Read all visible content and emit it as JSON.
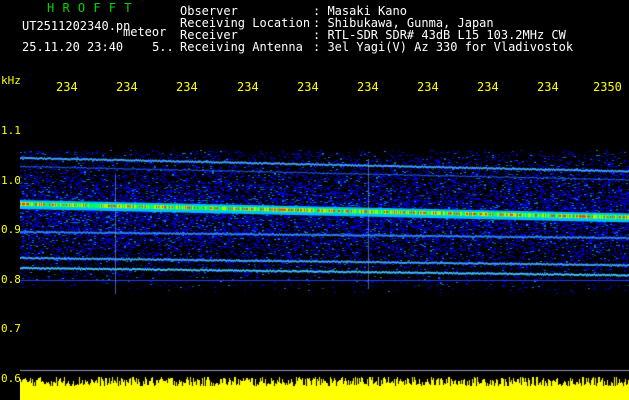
{
  "header": {
    "brand": "H R O F F T",
    "filename": "UT2511202340.pn",
    "meteor_label": "meteor",
    "datetime": "25.11.20 23:40",
    "datetime_extra": "5..",
    "rows": [
      {
        "label": "Observer",
        "value": ": Masaki Kano"
      },
      {
        "label": "Receiving Location",
        "value": ": Shibukawa, Gunma, Japan"
      },
      {
        "label": "Receiver",
        "value": ": RTL-SDR SDR# 43dB L15 103.2MHz CW"
      },
      {
        "label": "Receiving Antenna",
        "value": ": 3el Yagi(V) Az 330 for Vladivostok"
      }
    ]
  },
  "axes": {
    "unit": "kHz",
    "y_ticks": [
      "1.1",
      "1.0",
      "0.9",
      "0.8",
      "0.7",
      "0.6"
    ],
    "x_ticks": [
      "234",
      "234",
      "234",
      "234",
      "234",
      "234",
      "234",
      "234",
      "234",
      "2350"
    ]
  },
  "colors": {
    "brand": "#00d800",
    "text": "#ffffff",
    "axis": "#ffff00",
    "background": "#000000",
    "spectrum_base": "#0000b0",
    "power_bar": "#ffff00"
  }
}
